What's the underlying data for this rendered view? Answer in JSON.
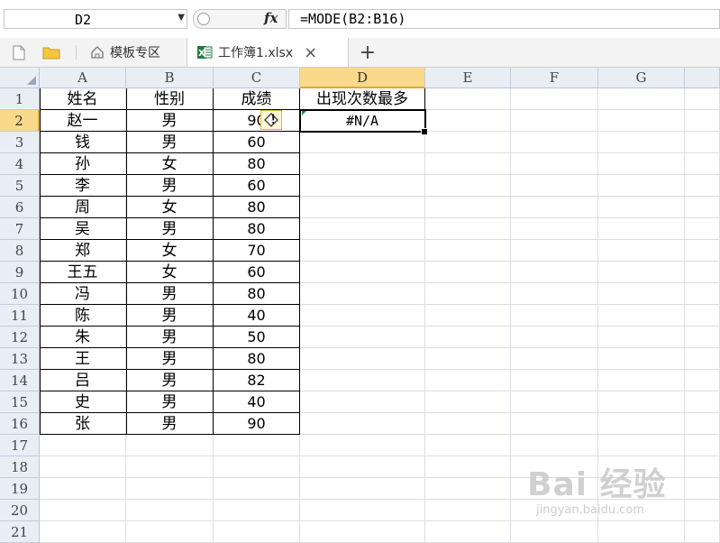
{
  "formula_bar": {
    "name_box": "D2",
    "fx_label": "fx",
    "formula": "=MODE(B2:B16)"
  },
  "tabs": {
    "template_label": "模板专区",
    "workbook_label": "工作簿1.xlsx",
    "close": "×",
    "new": "+"
  },
  "columns": [
    "A",
    "B",
    "C",
    "D",
    "E",
    "F",
    "G"
  ],
  "rows": [
    "1",
    "2",
    "3",
    "4",
    "5",
    "6",
    "7",
    "8",
    "9",
    "10",
    "11",
    "12",
    "13",
    "14",
    "15",
    "16",
    "17",
    "18",
    "19",
    "20",
    "21"
  ],
  "headers": {
    "a": "姓名",
    "b": "性别",
    "c": "成绩",
    "d": "出现次数最多"
  },
  "data_rows": [
    {
      "a": "赵一",
      "b": "男",
      "c": "90"
    },
    {
      "a": "钱",
      "b": "男",
      "c": "60"
    },
    {
      "a": "孙",
      "b": "女",
      "c": "80"
    },
    {
      "a": "李",
      "b": "男",
      "c": "60"
    },
    {
      "a": "周",
      "b": "女",
      "c": "80"
    },
    {
      "a": "吴",
      "b": "男",
      "c": "80"
    },
    {
      "a": "郑",
      "b": "女",
      "c": "70"
    },
    {
      "a": "王五",
      "b": "女",
      "c": "60"
    },
    {
      "a": "冯",
      "b": "男",
      "c": "80"
    },
    {
      "a": "陈",
      "b": "男",
      "c": "40"
    },
    {
      "a": "朱",
      "b": "男",
      "c": "50"
    },
    {
      "a": "王",
      "b": "男",
      "c": "80"
    },
    {
      "a": "吕",
      "b": "男",
      "c": "82"
    },
    {
      "a": "史",
      "b": "男",
      "c": "40"
    },
    {
      "a": "张",
      "b": "男",
      "c": "90"
    }
  ],
  "d2_value": "#N/A",
  "error_badge": "!",
  "watermark": {
    "logo": "Bai 经验",
    "sub": "jingyan.baidu.com"
  },
  "colors": {
    "selected_header": "#f9d98a",
    "accent": "#e2a73c",
    "excel_green": "#1f7a3f"
  }
}
